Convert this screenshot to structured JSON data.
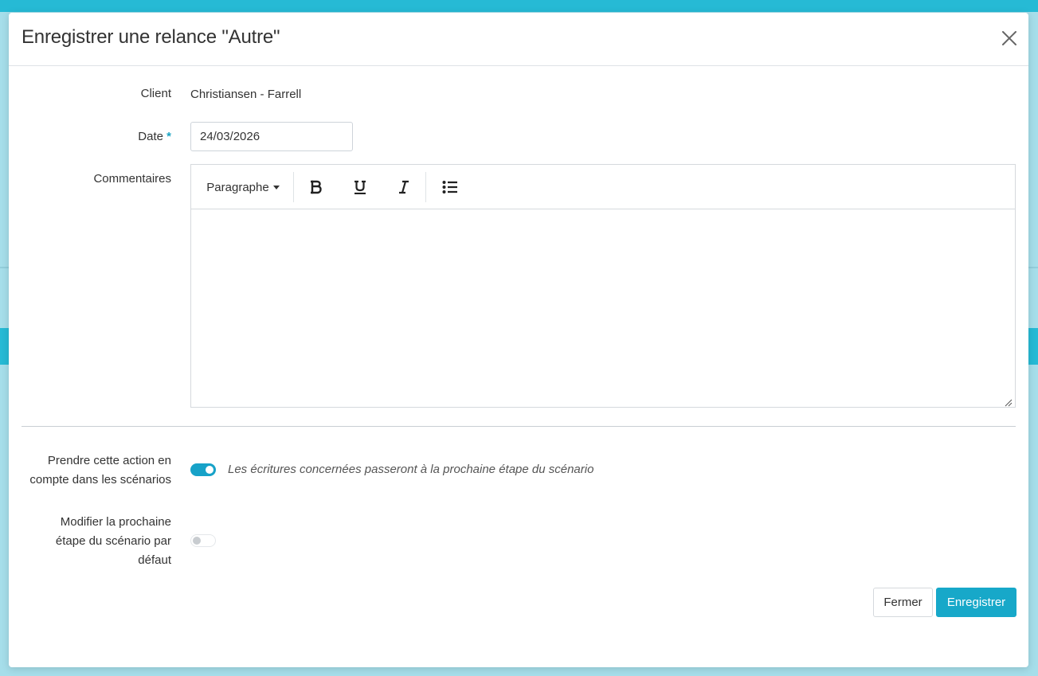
{
  "modal": {
    "title": "Enregistrer une relance \"Autre\""
  },
  "form": {
    "client_label": "Client",
    "client_value": "Christiansen - Farrell",
    "date_label": "Date",
    "date_required_mark": "*",
    "date_value": "24/03/2026",
    "comments_label": "Commentaires"
  },
  "editor": {
    "paragraph_label": "Paragraphe",
    "toolbar_icons": [
      "bold-icon",
      "underline-icon",
      "italic-icon",
      "bullet-list-icon"
    ]
  },
  "options": {
    "scenario_action_label_line1": "Prendre cette action en",
    "scenario_action_label_line2": "compte dans les scénarios",
    "scenario_action_enabled": true,
    "scenario_action_hint": "Les écritures concernées passeront à la prochaine étape du scénario",
    "next_step_label_line1": "Modifier la prochaine",
    "next_step_label_line2": "étape du scénario par",
    "next_step_label_line3": "défaut",
    "next_step_enabled": false
  },
  "buttons": {
    "close_label": "Fermer",
    "save_label": "Enregistrer"
  },
  "colors": {
    "accent": "#17a8c9",
    "backdrop": "#2abcd5"
  }
}
